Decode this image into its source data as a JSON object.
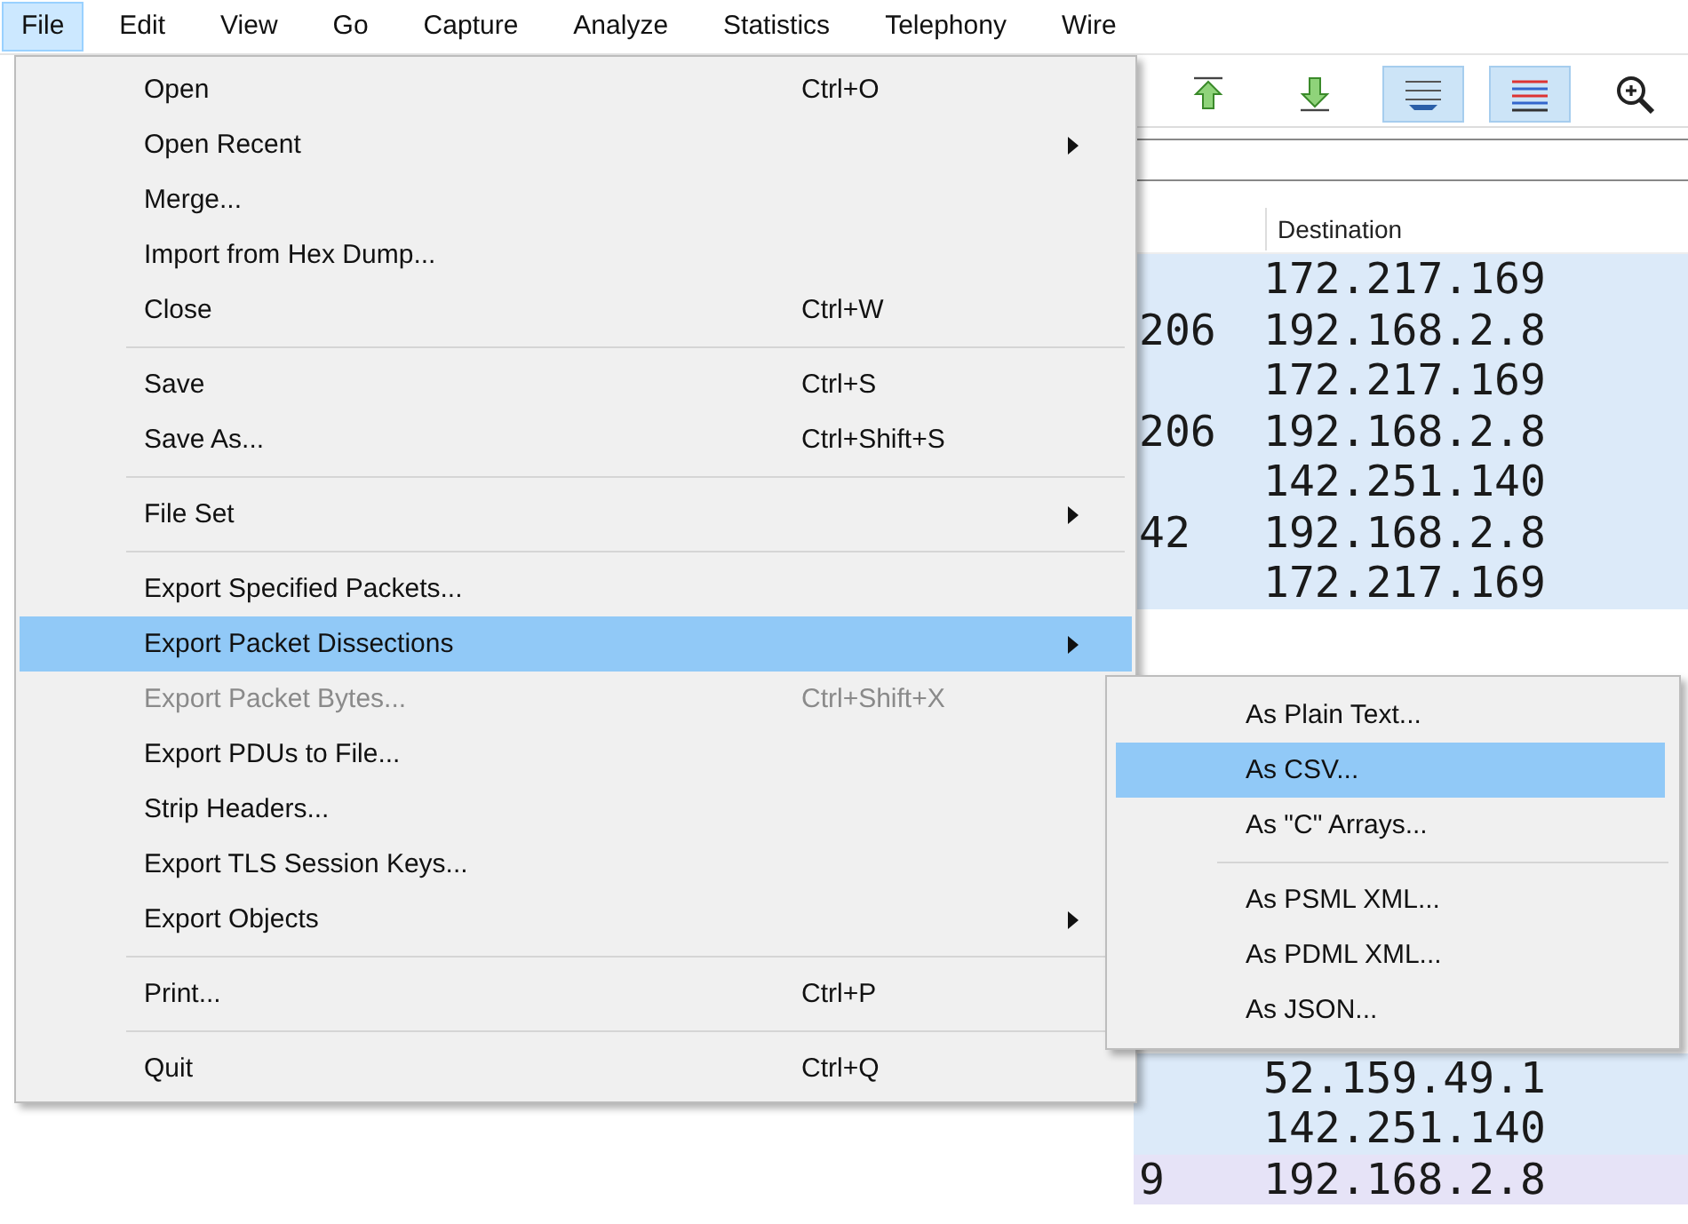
{
  "menu_bar": [
    {
      "label": "File",
      "selected": true
    },
    {
      "label": "Edit",
      "selected": false
    },
    {
      "label": "View",
      "selected": false
    },
    {
      "label": "Go",
      "selected": false
    },
    {
      "label": "Capture",
      "selected": false
    },
    {
      "label": "Analyze",
      "selected": false
    },
    {
      "label": "Statistics",
      "selected": false
    },
    {
      "label": "Telephony",
      "selected": false
    },
    {
      "label": "Wire",
      "selected": false
    }
  ],
  "toolbar": [
    {
      "kind": "go-first",
      "on": false
    },
    {
      "kind": "go-last",
      "on": false
    },
    {
      "kind": "autoscroll",
      "on": true
    },
    {
      "kind": "colorize",
      "on": true
    },
    {
      "kind": "zoom-in",
      "on": false
    }
  ],
  "packet_list": {
    "columns": [
      "Destination"
    ],
    "rows_top": [
      {
        "destination": "172.217.169",
        "color": "#dceaf9"
      },
      {
        "column_1": "206",
        "destination": "192.168.2.8",
        "color": "#dceaf9"
      },
      {
        "destination": "172.217.169",
        "color": "#dceaf9"
      },
      {
        "column_1": "206",
        "destination": "192.168.2.8",
        "color": "#dceaf9"
      },
      {
        "destination": "142.251.140",
        "color": "#dceaf9"
      },
      {
        "column_1": "42",
        "destination": "192.168.2.8",
        "color": "#dceaf9"
      },
      {
        "destination": "172.217.169",
        "color": "#dceaf9"
      }
    ],
    "rows_bottom": [
      {
        "destination": "52.159.49.1",
        "color": "#dceaf9"
      },
      {
        "destination": "142.251.140",
        "color": "#dceaf9"
      },
      {
        "column_1": "9",
        "destination": "192.168.2.8",
        "color": "#e6e3f7"
      }
    ]
  },
  "file_menu": {
    "items": [
      {
        "kind": "item",
        "label": "Open",
        "shortcut": "Ctrl+O",
        "submenu": false,
        "selected": false,
        "disabled": false
      },
      {
        "kind": "item",
        "label": "Open Recent",
        "submenu": true,
        "selected": false,
        "disabled": false
      },
      {
        "kind": "item",
        "label": "Merge...",
        "submenu": false,
        "selected": false,
        "disabled": false
      },
      {
        "kind": "item",
        "label": "Import from Hex Dump...",
        "submenu": false,
        "selected": false,
        "disabled": false
      },
      {
        "kind": "item",
        "label": "Close",
        "shortcut": "Ctrl+W",
        "submenu": false,
        "selected": false,
        "disabled": false
      },
      {
        "kind": "separator"
      },
      {
        "kind": "item",
        "label": "Save",
        "shortcut": "Ctrl+S",
        "submenu": false,
        "selected": false,
        "disabled": false
      },
      {
        "kind": "item",
        "label": "Save As...",
        "shortcut": "Ctrl+Shift+S",
        "submenu": false,
        "selected": false,
        "disabled": false
      },
      {
        "kind": "separator"
      },
      {
        "kind": "item",
        "label": "File Set",
        "submenu": true,
        "selected": false,
        "disabled": false
      },
      {
        "kind": "separator"
      },
      {
        "kind": "item",
        "label": "Export Specified Packets...",
        "submenu": false,
        "selected": false,
        "disabled": false
      },
      {
        "kind": "item",
        "label": "Export Packet Dissections",
        "submenu": true,
        "selected": true,
        "disabled": false
      },
      {
        "kind": "item",
        "label": "Export Packet Bytes...",
        "shortcut": "Ctrl+Shift+X",
        "submenu": false,
        "selected": false,
        "disabled": true
      },
      {
        "kind": "item",
        "label": "Export PDUs to File...",
        "submenu": false,
        "selected": false,
        "disabled": false
      },
      {
        "kind": "item",
        "label": "Strip Headers...",
        "submenu": false,
        "selected": false,
        "disabled": false
      },
      {
        "kind": "item",
        "label": "Export TLS Session Keys...",
        "submenu": false,
        "selected": false,
        "disabled": false
      },
      {
        "kind": "item",
        "label": "Export Objects",
        "submenu": true,
        "selected": false,
        "disabled": false
      },
      {
        "kind": "separator"
      },
      {
        "kind": "item",
        "label": "Print...",
        "shortcut": "Ctrl+P",
        "submenu": false,
        "selected": false,
        "disabled": false
      },
      {
        "kind": "separator"
      },
      {
        "kind": "item",
        "label": "Quit",
        "shortcut": "Ctrl+Q",
        "submenu": false,
        "selected": false,
        "disabled": false
      }
    ]
  },
  "submenu": {
    "items": [
      {
        "kind": "item",
        "label": "As Plain Text...",
        "selected": false
      },
      {
        "kind": "item",
        "label": "As CSV...",
        "selected": true
      },
      {
        "kind": "item",
        "label": "As \"C\" Arrays...",
        "selected": false
      },
      {
        "kind": "separator"
      },
      {
        "kind": "item",
        "label": "As PSML XML...",
        "selected": false
      },
      {
        "kind": "item",
        "label": "As PDML XML...",
        "selected": false
      },
      {
        "kind": "item",
        "label": "As JSON...",
        "selected": false
      }
    ]
  }
}
